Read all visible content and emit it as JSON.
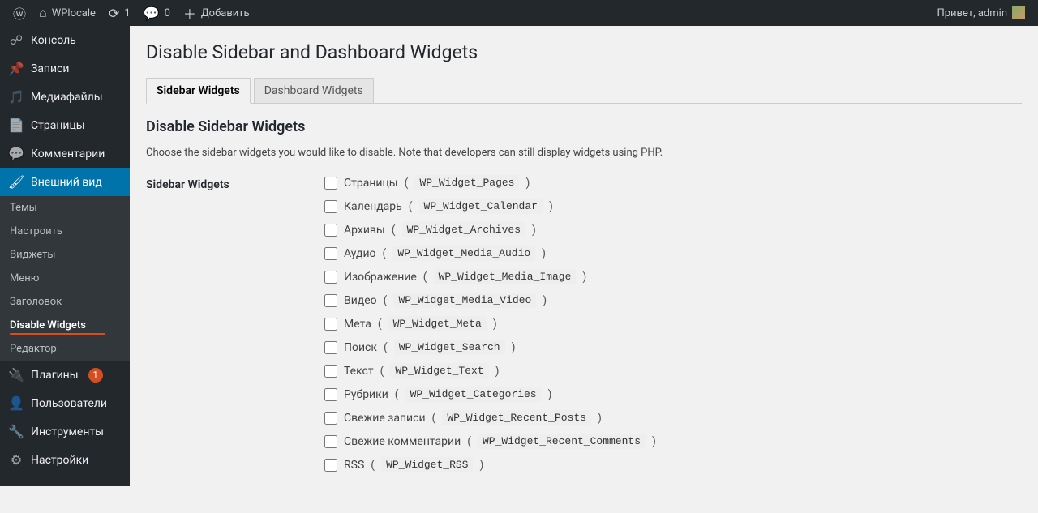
{
  "adminbar": {
    "site_name": "WPlocale",
    "updates_count": "1",
    "comments_count": "0",
    "add_new": "Добавить",
    "greeting": "Привет, admin"
  },
  "sidebar": {
    "items": [
      {
        "label": "Консоль",
        "icon": "dashboard"
      },
      {
        "label": "Записи",
        "icon": "pin"
      },
      {
        "label": "Медиафайлы",
        "icon": "media"
      },
      {
        "label": "Страницы",
        "icon": "page"
      },
      {
        "label": "Комментарии",
        "icon": "comment"
      },
      {
        "label": "Внешний вид",
        "icon": "appearance",
        "current": true
      },
      {
        "label": "Плагины",
        "icon": "plugin",
        "badge": "1"
      },
      {
        "label": "Пользователи",
        "icon": "users"
      },
      {
        "label": "Инструменты",
        "icon": "tools"
      },
      {
        "label": "Настройки",
        "icon": "settings"
      }
    ],
    "appearance_submenu": [
      "Темы",
      "Настроить",
      "Виджеты",
      "Меню",
      "Заголовок",
      "Disable Widgets",
      "Редактор"
    ],
    "appearance_submenu_current": "Disable Widgets"
  },
  "page": {
    "title": "Disable Sidebar and Dashboard Widgets",
    "tabs": [
      {
        "label": "Sidebar Widgets",
        "active": true
      },
      {
        "label": "Dashboard Widgets",
        "active": false
      }
    ],
    "section_heading": "Disable Sidebar Widgets",
    "description": "Choose the sidebar widgets you would like to disable. Note that developers can still display widgets using PHP.",
    "form_label": "Sidebar Widgets",
    "widgets": [
      {
        "name": "Страницы",
        "code": "WP_Widget_Pages"
      },
      {
        "name": "Календарь",
        "code": "WP_Widget_Calendar"
      },
      {
        "name": "Архивы",
        "code": "WP_Widget_Archives"
      },
      {
        "name": "Аудио",
        "code": "WP_Widget_Media_Audio"
      },
      {
        "name": "Изображение",
        "code": "WP_Widget_Media_Image"
      },
      {
        "name": "Видео",
        "code": "WP_Widget_Media_Video"
      },
      {
        "name": "Мета",
        "code": "WP_Widget_Meta"
      },
      {
        "name": "Поиск",
        "code": "WP_Widget_Search"
      },
      {
        "name": "Текст",
        "code": "WP_Widget_Text"
      },
      {
        "name": "Рубрики",
        "code": "WP_Widget_Categories"
      },
      {
        "name": "Свежие записи",
        "code": "WP_Widget_Recent_Posts"
      },
      {
        "name": "Свежие комментарии",
        "code": "WP_Widget_Recent_Comments"
      },
      {
        "name": "RSS",
        "code": "WP_Widget_RSS"
      }
    ]
  }
}
